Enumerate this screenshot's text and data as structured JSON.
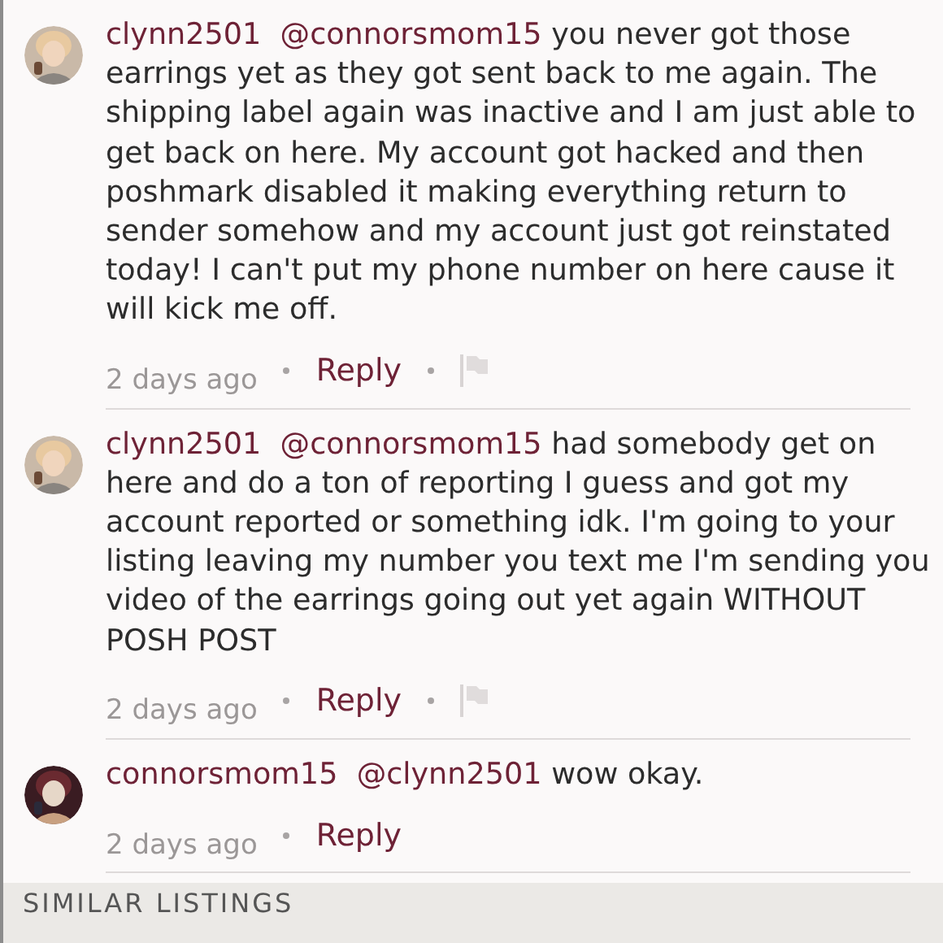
{
  "comments": [
    {
      "username": "clynn2501",
      "mention": "@connorsmom15",
      "text": "you never got those earrings yet as they got sent back to me again. The shipping label again was inactive and I am just able to get back on here. My account got hacked and then poshmark disabled it making everything return to sender somehow and my account just got reinstated today! I can't put my phone number on here cause it will kick me off.",
      "time": "2 days ago",
      "reply": "Reply",
      "flag": true
    },
    {
      "username": "clynn2501",
      "mention": "@connorsmom15",
      "text": "had somebody get on here and do a ton of reporting I guess and got my account reported or something idk. I'm going to your listing leaving my number you text me I'm sending you video of the earrings going out yet again WITHOUT POSH POST",
      "time": "2 days ago",
      "reply": "Reply",
      "flag": true
    },
    {
      "username": "connorsmom15",
      "mention": "@clynn2501",
      "text": "wow okay.",
      "time": "2 days ago",
      "reply": "Reply",
      "flag": false
    }
  ],
  "section": {
    "title": "SIMILAR LISTINGS"
  }
}
